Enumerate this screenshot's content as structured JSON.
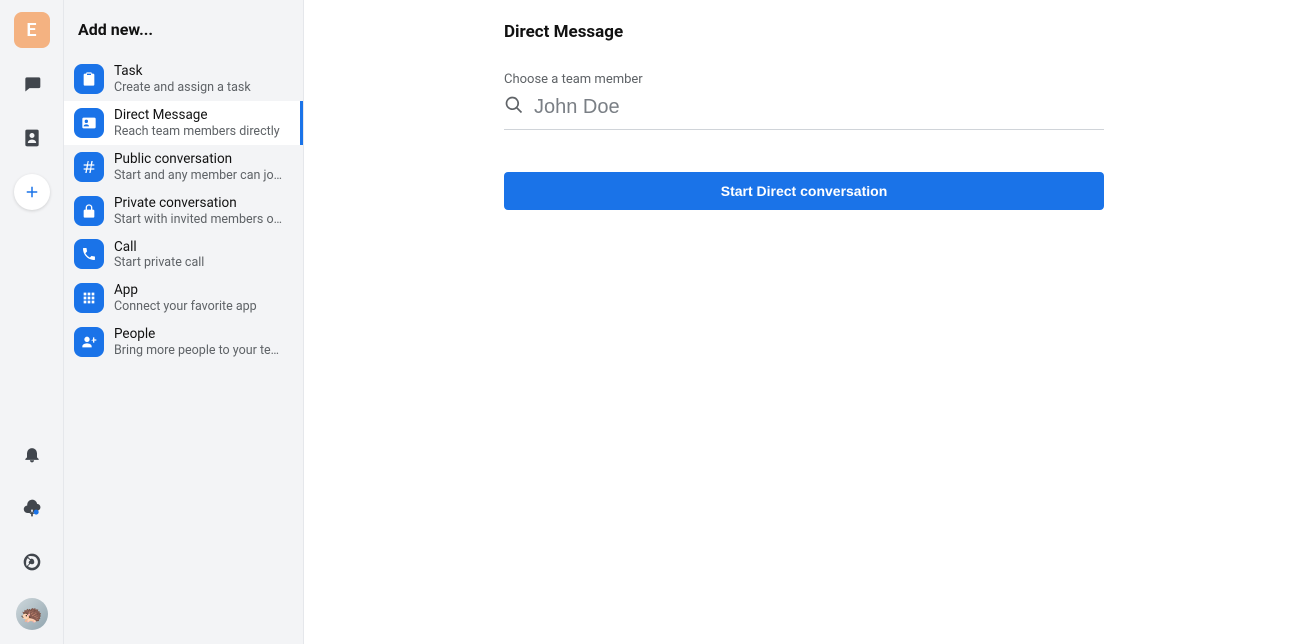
{
  "rail": {
    "workspace_initial": "E"
  },
  "panel": {
    "header": "Add new..."
  },
  "items": [
    {
      "title": "Task",
      "subtitle": "Create and assign a task",
      "icon": "clipboard"
    },
    {
      "title": "Direct Message",
      "subtitle": "Reach team members directly",
      "icon": "id-card",
      "selected": true
    },
    {
      "title": "Public conversation",
      "subtitle": "Start and any member can jo…",
      "icon": "hash"
    },
    {
      "title": "Private conversation",
      "subtitle": "Start with invited members o…",
      "icon": "lock"
    },
    {
      "title": "Call",
      "subtitle": "Start private call",
      "icon": "phone"
    },
    {
      "title": "App",
      "subtitle": "Connect your favorite app",
      "icon": "grid"
    },
    {
      "title": "People",
      "subtitle": "Bring more people to your te…",
      "icon": "person-add"
    }
  ],
  "main": {
    "title": "Direct Message",
    "field_label": "Choose a team member",
    "search_placeholder": "John Doe",
    "button_label": "Start Direct conversation"
  }
}
